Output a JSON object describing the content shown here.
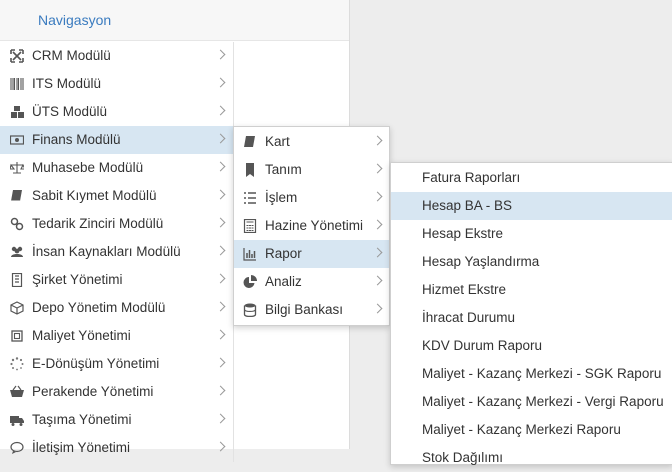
{
  "nav": {
    "title": "Navigasyon"
  },
  "menu": {
    "items": [
      {
        "label": "CRM Modülü",
        "icon": "crm-icon"
      },
      {
        "label": "ITS Modülü",
        "icon": "barcode-icon"
      },
      {
        "label": "ÜTS Modülü",
        "icon": "cubes-icon"
      },
      {
        "label": "Finans Modülü",
        "icon": "money-icon"
      },
      {
        "label": "Muhasebe Modülü",
        "icon": "scale-icon"
      },
      {
        "label": "Sabit Kıymet Modülü",
        "icon": "book-icon"
      },
      {
        "label": "Tedarik Zinciri Modülü",
        "icon": "link-icon"
      },
      {
        "label": "İnsan Kaynakları Modülü",
        "icon": "users-icon"
      },
      {
        "label": "Şirket Yönetimi",
        "icon": "building-icon"
      },
      {
        "label": "Depo Yönetim Modülü",
        "icon": "box-icon"
      },
      {
        "label": "Maliyet Yönetimi",
        "icon": "crop-icon"
      },
      {
        "label": "E-Dönüşüm Yönetimi",
        "icon": "spinner-icon"
      },
      {
        "label": "Perakende Yönetimi",
        "icon": "basket-icon"
      },
      {
        "label": "Taşıma Yönetimi",
        "icon": "truck-icon"
      },
      {
        "label": "İletişim Yönetimi",
        "icon": "chat-icon"
      }
    ]
  },
  "finans_submenu": {
    "items": [
      {
        "label": "Kart",
        "icon": "book-icon"
      },
      {
        "label": "Tanım",
        "icon": "bookmark-icon"
      },
      {
        "label": "İşlem",
        "icon": "list-icon"
      },
      {
        "label": "Hazine Yönetimi",
        "icon": "calculator-icon"
      },
      {
        "label": "Rapor",
        "icon": "bar-chart-icon"
      },
      {
        "label": "Analiz",
        "icon": "pie-chart-icon"
      },
      {
        "label": "Bilgi Bankası",
        "icon": "database-icon"
      }
    ]
  },
  "rapor_submenu": {
    "items": [
      "Fatura Raporları",
      "Hesap BA - BS",
      "Hesap Ekstre",
      "Hesap Yaşlandırma",
      "Hizmet Ekstre",
      "İhracat Durumu",
      "KDV Durum Raporu",
      "Maliyet - Kazanç Merkezi - SGK Raporu",
      "Maliyet - Kazanç Merkezi - Vergi Raporu",
      "Maliyet - Kazanç Merkezi Raporu",
      "Stok Dağılımı"
    ]
  },
  "colors": {
    "accent": "#3a7bbf",
    "active_bg": "#d7e6f2"
  }
}
